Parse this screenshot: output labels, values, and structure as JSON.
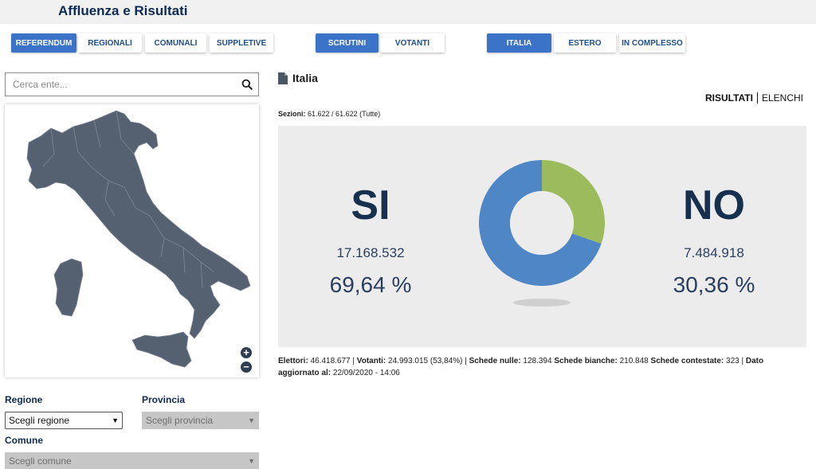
{
  "header": {
    "title": "Affluenza e Risultati"
  },
  "nav": {
    "election_types": [
      {
        "label": "REFERENDUM",
        "active": true
      },
      {
        "label": "REGIONALI",
        "active": false
      },
      {
        "label": "COMUNALI",
        "active": false
      },
      {
        "label": "SUPPLETIVE",
        "active": false
      }
    ],
    "data_types": [
      {
        "label": "SCRUTINI",
        "active": true
      },
      {
        "label": "VOTANTI",
        "active": false
      }
    ],
    "scopes": [
      {
        "label": "ITALIA",
        "active": true
      },
      {
        "label": "ESTERO",
        "active": false
      },
      {
        "label": "IN COMPLESSO",
        "active": false
      }
    ]
  },
  "search": {
    "placeholder": "Cerca ente..."
  },
  "filters": {
    "regione_label": "Regione",
    "regione_value": "Scegli regione",
    "provincia_label": "Provincia",
    "provincia_value": "Scegli provincia",
    "comune_label": "Comune",
    "comune_value": "Scegli comune"
  },
  "map": {
    "zoom_in": "+",
    "zoom_out": "−"
  },
  "results": {
    "title": "Italia",
    "tab_results": "RISULTATI",
    "tab_lists": "ELENCHI",
    "sezioni_label": "Sezioni:",
    "sezioni_value": "61.622 / 61.622 (Tutte)",
    "yes": {
      "label": "SI",
      "votes": "17.168.532",
      "percent": "69,64 %",
      "share": 69.64,
      "color": "#4f86c6"
    },
    "no": {
      "label": "NO",
      "votes": "7.484.918",
      "percent": "30,36 %",
      "share": 30.36,
      "color": "#9cbb5d"
    }
  },
  "footer": {
    "elettori_label": "Elettori:",
    "elettori_value": "46.418.677",
    "votanti_label": "Votanti:",
    "votanti_value": "24.993.015 (53,84%)",
    "nulle_label": "Schede nulle:",
    "nulle_value": "128.394",
    "bianche_label": "Schede bianche:",
    "bianche_value": "210.848",
    "contestate_label": "Schede contestate:",
    "contestate_value": "323",
    "dato_label": "Dato aggiornato al:",
    "dato_value": "22/09/2020 - 14:06"
  },
  "colors": {
    "accent": "#3b73c8",
    "dark_text": "#0d2a52",
    "map_fill": "#556070"
  },
  "icons": {
    "search": "search-icon",
    "document": "document-icon",
    "zoom_in": "zoom-in-icon",
    "zoom_out": "zoom-out-icon"
  }
}
